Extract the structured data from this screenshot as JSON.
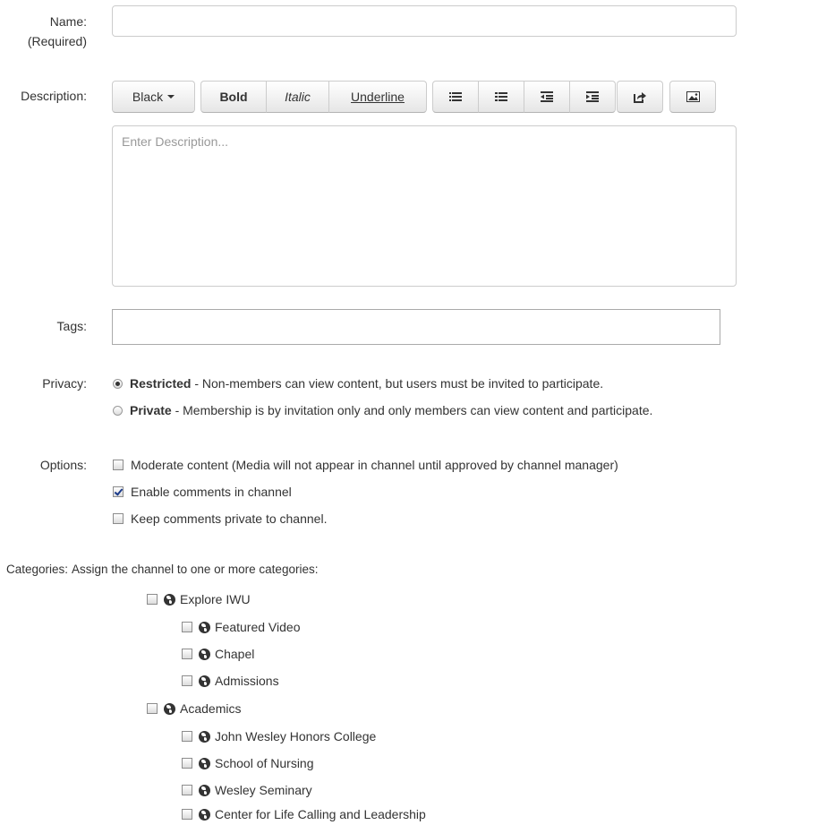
{
  "name": {
    "label": "Name:",
    "sublabel": "(Required)",
    "value": ""
  },
  "description": {
    "label": "Description:",
    "placeholder": "Enter Description...",
    "toolbar": {
      "color": "Black",
      "bold": "Bold",
      "italic": "Italic",
      "underline": "Underline",
      "icons": [
        "unordered-list-icon",
        "ordered-list-icon",
        "outdent-icon",
        "indent-icon",
        "link-icon",
        "image-icon"
      ]
    }
  },
  "tags": {
    "label": "Tags:",
    "value": ""
  },
  "privacy": {
    "label": "Privacy:",
    "options": [
      {
        "title": "Restricted",
        "desc": " - Non-members can view content, but users must be invited to participate.",
        "checked": true
      },
      {
        "title": "Private",
        "desc": " - Membership is by invitation only and only members can view content and participate.",
        "checked": false
      }
    ]
  },
  "options": {
    "label": "Options:",
    "items": [
      {
        "text": "Moderate content (Media will not appear in channel until approved by channel manager)",
        "checked": false
      },
      {
        "text": "Enable comments in channel",
        "checked": true
      },
      {
        "text": "Keep comments private to channel.",
        "checked": false
      }
    ]
  },
  "categories": {
    "label": "Categories:",
    "hint": "Assign the channel to one or more categories:",
    "items": [
      {
        "text": "Explore IWU",
        "level": 0
      },
      {
        "text": "Featured Video",
        "level": 1
      },
      {
        "text": "Chapel",
        "level": 1
      },
      {
        "text": "Admissions",
        "level": 1
      },
      {
        "text": "Academics",
        "level": 0
      },
      {
        "text": "John Wesley Honors College",
        "level": 1
      },
      {
        "text": "School of Nursing",
        "level": 1
      },
      {
        "text": "Wesley Seminary",
        "level": 1
      },
      {
        "text": "Center for Life Calling and Leadership",
        "level": 1
      }
    ]
  }
}
